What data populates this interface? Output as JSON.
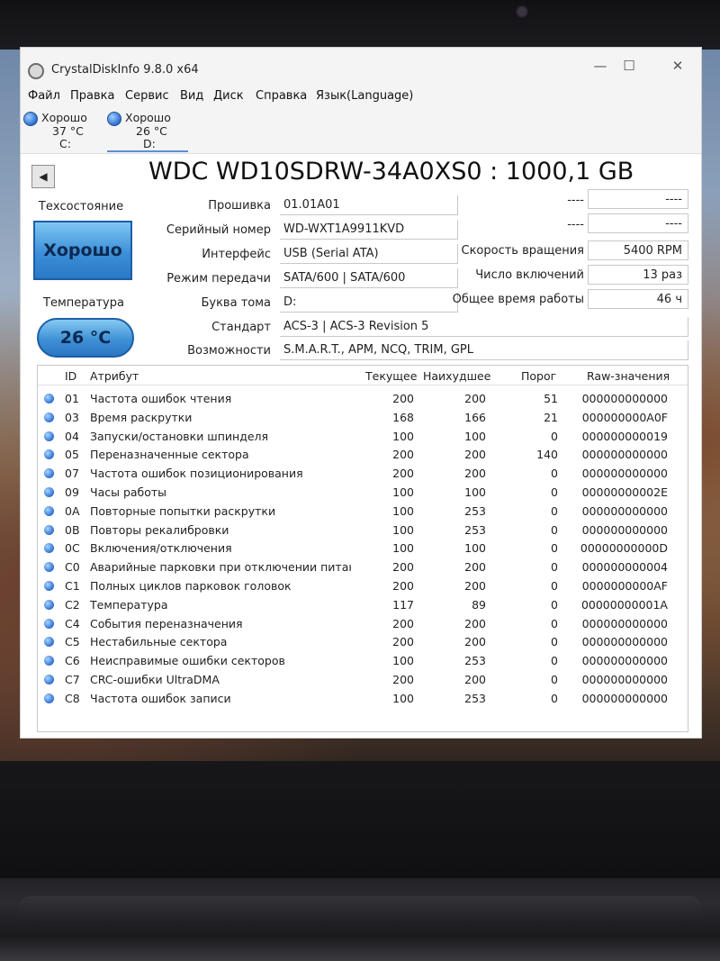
{
  "window": {
    "title": "CrystalDiskInfo 9.8.0 x64",
    "minimize_glyph": "—",
    "maximize_glyph": "☐",
    "close_glyph": "✕"
  },
  "menu": [
    "Файл",
    "Правка",
    "Сервис",
    "Вид",
    "Диск",
    "Справка",
    "Язык(Language)"
  ],
  "disk_tabs": [
    {
      "status": "Хорошо",
      "temp": "37 °C",
      "letter": "C:"
    },
    {
      "status": "Хорошо",
      "temp": "26 °C",
      "letter": "D:"
    }
  ],
  "model": "WDC WD10SDRW-34A0XS0 : 1000,1 GB",
  "prev_glyph": "◀",
  "health": {
    "label": "Техсостояние",
    "value": "Хорошо"
  },
  "temperature": {
    "label": "Температура",
    "value": "26 °C"
  },
  "info": [
    {
      "label": "Прошивка",
      "value": "01.01A01"
    },
    {
      "label": "Серийный номер",
      "value": "WD-WXT1A9911KVD"
    },
    {
      "label": "Интерфейс",
      "value": "USB (Serial ATA)"
    },
    {
      "label": "Режим передачи",
      "value": "SATA/600 | SATA/600"
    },
    {
      "label": "Буква тома",
      "value": "D:"
    },
    {
      "label": "Стандарт",
      "value": "ACS-3 | ACS-3 Revision 5"
    },
    {
      "label": "Возможности",
      "value": "S.M.A.R.T., APM, NCQ, TRIM, GPL"
    }
  ],
  "right_info": [
    {
      "label": "----",
      "value": "----"
    },
    {
      "label": "----",
      "value": "----"
    },
    {
      "label": "Скорость вращения",
      "value": "5400 RPM"
    },
    {
      "label": "Число включений",
      "value": "13 раз"
    },
    {
      "label": "Общее время работы",
      "value": "46 ч"
    }
  ],
  "table": {
    "headers": {
      "id": "ID",
      "attr": "Атрибут",
      "current": "Текущее",
      "worst": "Наихудшее",
      "threshold": "Порог",
      "raw": "Raw-значения"
    },
    "rows": [
      {
        "id": "01",
        "attr": "Частота ошибок чтения",
        "current": "200",
        "worst": "200",
        "threshold": "51",
        "raw": "000000000000"
      },
      {
        "id": "03",
        "attr": "Время раскрутки",
        "current": "168",
        "worst": "166",
        "threshold": "21",
        "raw": "000000000A0F"
      },
      {
        "id": "04",
        "attr": "Запуски/остановки шпинделя",
        "current": "100",
        "worst": "100",
        "threshold": "0",
        "raw": "000000000019"
      },
      {
        "id": "05",
        "attr": "Переназначенные сектора",
        "current": "200",
        "worst": "200",
        "threshold": "140",
        "raw": "000000000000"
      },
      {
        "id": "07",
        "attr": "Частота ошибок позиционирования",
        "current": "200",
        "worst": "200",
        "threshold": "0",
        "raw": "000000000000"
      },
      {
        "id": "09",
        "attr": "Часы работы",
        "current": "100",
        "worst": "100",
        "threshold": "0",
        "raw": "00000000002E"
      },
      {
        "id": "0A",
        "attr": "Повторные попытки раскрутки",
        "current": "100",
        "worst": "253",
        "threshold": "0",
        "raw": "000000000000"
      },
      {
        "id": "0B",
        "attr": "Повторы рекалибровки",
        "current": "100",
        "worst": "253",
        "threshold": "0",
        "raw": "000000000000"
      },
      {
        "id": "0C",
        "attr": "Включения/отключения",
        "current": "100",
        "worst": "100",
        "threshold": "0",
        "raw": "00000000000D"
      },
      {
        "id": "C0",
        "attr": "Аварийные парковки при отключении питан...",
        "current": "200",
        "worst": "200",
        "threshold": "0",
        "raw": "000000000004"
      },
      {
        "id": "C1",
        "attr": "Полных циклов парковок головок",
        "current": "200",
        "worst": "200",
        "threshold": "0",
        "raw": "0000000000AF"
      },
      {
        "id": "C2",
        "attr": "Температура",
        "current": "117",
        "worst": "89",
        "threshold": "0",
        "raw": "00000000001A"
      },
      {
        "id": "C4",
        "attr": "События переназначения",
        "current": "200",
        "worst": "200",
        "threshold": "0",
        "raw": "000000000000"
      },
      {
        "id": "C5",
        "attr": "Нестабильные сектора",
        "current": "200",
        "worst": "200",
        "threshold": "0",
        "raw": "000000000000"
      },
      {
        "id": "C6",
        "attr": "Неисправимые ошибки секторов",
        "current": "100",
        "worst": "253",
        "threshold": "0",
        "raw": "000000000000"
      },
      {
        "id": "C7",
        "attr": "CRC-ошибки UltraDMA",
        "current": "200",
        "worst": "200",
        "threshold": "0",
        "raw": "000000000000"
      },
      {
        "id": "C8",
        "attr": "Частота ошибок записи",
        "current": "100",
        "worst": "253",
        "threshold": "0",
        "raw": "000000000000"
      }
    ]
  },
  "colors": {
    "status_good": "#3c8fd8",
    "accent": "#5a8ed6"
  }
}
